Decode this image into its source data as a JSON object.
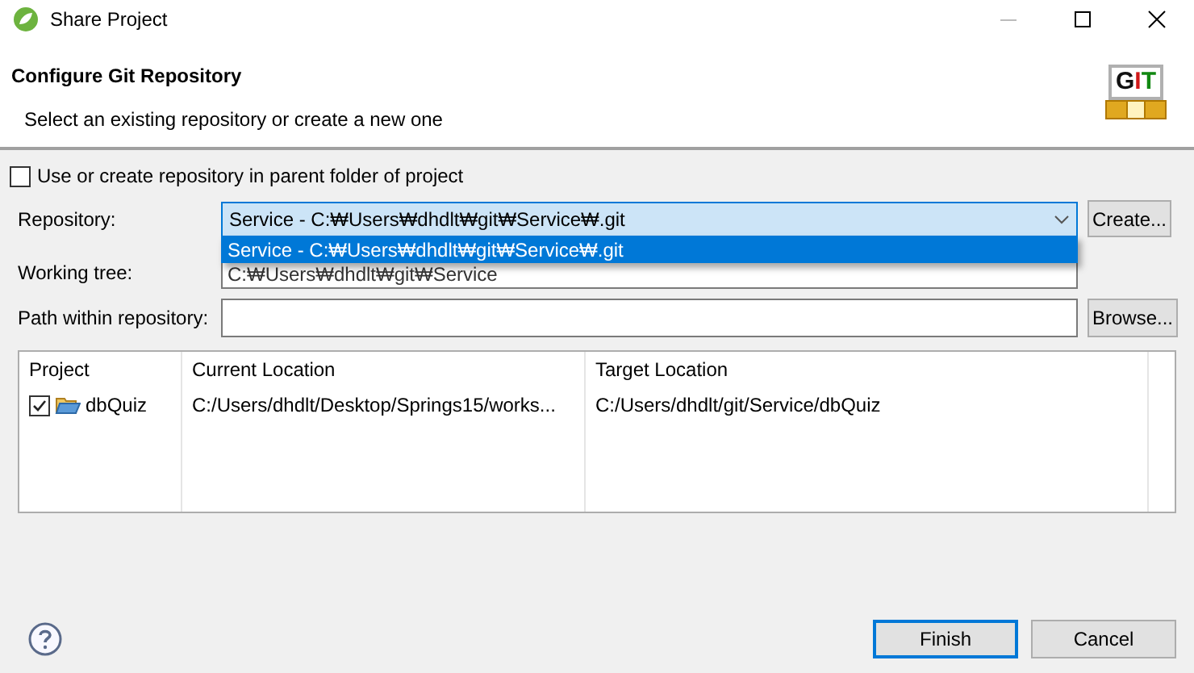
{
  "window": {
    "title": "Share Project"
  },
  "header": {
    "title": "Configure Git Repository",
    "subtitle": "Select an existing repository or create a new one",
    "logo_text": "GIT"
  },
  "parent_folder_option": {
    "label": "Use or create repository in parent folder of project",
    "checked": false
  },
  "repository": {
    "label": "Repository:",
    "value": "Service - C:₩Users₩dhdlt₩git₩Service₩.git",
    "button": "Create...",
    "dropdown": [
      {
        "label": "Service - C:₩Users₩dhdlt₩git₩Service₩.git",
        "selected": true
      }
    ]
  },
  "working_tree": {
    "label": "Working tree:",
    "value": "C:₩Users₩dhdlt₩git₩Service"
  },
  "path_within_repository": {
    "label": "Path within repository:",
    "button": "Browse..."
  },
  "table": {
    "columns": [
      "Project",
      "Current Location",
      "Target Location"
    ],
    "rows": [
      {
        "project": "dbQuiz",
        "checked": true,
        "current_location": "C:/Users/dhdlt/Desktop/Springs15/works...",
        "target_location": "C:/Users/dhdlt/git/Service/dbQuiz"
      }
    ]
  },
  "buttons": [
    {
      "label": "Finish",
      "default": true
    },
    {
      "label": "Cancel",
      "default": false
    }
  ]
}
